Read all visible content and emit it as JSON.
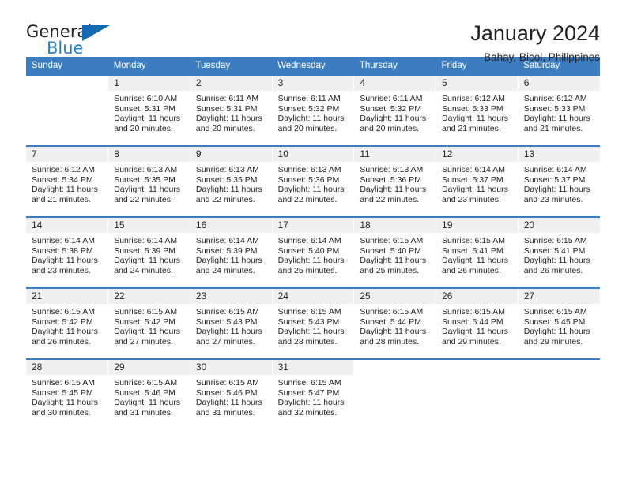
{
  "brand": {
    "name_part1": "General",
    "name_part2": "Blue",
    "triangle_color": "#1268b3",
    "blue_color": "#2a7fc4"
  },
  "header": {
    "title": "January 2024",
    "subtitle": "Bahay, Bicol, Philippines"
  },
  "theme": {
    "header_bg": "#3b7dc0",
    "daynum_bg": "#f0f0f0",
    "text_color": "#231f20"
  },
  "calendar": {
    "weekdays": [
      "Sunday",
      "Monday",
      "Tuesday",
      "Wednesday",
      "Thursday",
      "Friday",
      "Saturday"
    ],
    "weeks": [
      [
        {
          "day": ""
        },
        {
          "day": "1",
          "sunrise": "Sunrise: 6:10 AM",
          "sunset": "Sunset: 5:31 PM",
          "daylight1": "Daylight: 11 hours",
          "daylight2": "and 20 minutes."
        },
        {
          "day": "2",
          "sunrise": "Sunrise: 6:11 AM",
          "sunset": "Sunset: 5:31 PM",
          "daylight1": "Daylight: 11 hours",
          "daylight2": "and 20 minutes."
        },
        {
          "day": "3",
          "sunrise": "Sunrise: 6:11 AM",
          "sunset": "Sunset: 5:32 PM",
          "daylight1": "Daylight: 11 hours",
          "daylight2": "and 20 minutes."
        },
        {
          "day": "4",
          "sunrise": "Sunrise: 6:11 AM",
          "sunset": "Sunset: 5:32 PM",
          "daylight1": "Daylight: 11 hours",
          "daylight2": "and 20 minutes."
        },
        {
          "day": "5",
          "sunrise": "Sunrise: 6:12 AM",
          "sunset": "Sunset: 5:33 PM",
          "daylight1": "Daylight: 11 hours",
          "daylight2": "and 21 minutes."
        },
        {
          "day": "6",
          "sunrise": "Sunrise: 6:12 AM",
          "sunset": "Sunset: 5:33 PM",
          "daylight1": "Daylight: 11 hours",
          "daylight2": "and 21 minutes."
        }
      ],
      [
        {
          "day": "7",
          "sunrise": "Sunrise: 6:12 AM",
          "sunset": "Sunset: 5:34 PM",
          "daylight1": "Daylight: 11 hours",
          "daylight2": "and 21 minutes."
        },
        {
          "day": "8",
          "sunrise": "Sunrise: 6:13 AM",
          "sunset": "Sunset: 5:35 PM",
          "daylight1": "Daylight: 11 hours",
          "daylight2": "and 22 minutes."
        },
        {
          "day": "9",
          "sunrise": "Sunrise: 6:13 AM",
          "sunset": "Sunset: 5:35 PM",
          "daylight1": "Daylight: 11 hours",
          "daylight2": "and 22 minutes."
        },
        {
          "day": "10",
          "sunrise": "Sunrise: 6:13 AM",
          "sunset": "Sunset: 5:36 PM",
          "daylight1": "Daylight: 11 hours",
          "daylight2": "and 22 minutes."
        },
        {
          "day": "11",
          "sunrise": "Sunrise: 6:13 AM",
          "sunset": "Sunset: 5:36 PM",
          "daylight1": "Daylight: 11 hours",
          "daylight2": "and 22 minutes."
        },
        {
          "day": "12",
          "sunrise": "Sunrise: 6:14 AM",
          "sunset": "Sunset: 5:37 PM",
          "daylight1": "Daylight: 11 hours",
          "daylight2": "and 23 minutes."
        },
        {
          "day": "13",
          "sunrise": "Sunrise: 6:14 AM",
          "sunset": "Sunset: 5:37 PM",
          "daylight1": "Daylight: 11 hours",
          "daylight2": "and 23 minutes."
        }
      ],
      [
        {
          "day": "14",
          "sunrise": "Sunrise: 6:14 AM",
          "sunset": "Sunset: 5:38 PM",
          "daylight1": "Daylight: 11 hours",
          "daylight2": "and 23 minutes."
        },
        {
          "day": "15",
          "sunrise": "Sunrise: 6:14 AM",
          "sunset": "Sunset: 5:39 PM",
          "daylight1": "Daylight: 11 hours",
          "daylight2": "and 24 minutes."
        },
        {
          "day": "16",
          "sunrise": "Sunrise: 6:14 AM",
          "sunset": "Sunset: 5:39 PM",
          "daylight1": "Daylight: 11 hours",
          "daylight2": "and 24 minutes."
        },
        {
          "day": "17",
          "sunrise": "Sunrise: 6:14 AM",
          "sunset": "Sunset: 5:40 PM",
          "daylight1": "Daylight: 11 hours",
          "daylight2": "and 25 minutes."
        },
        {
          "day": "18",
          "sunrise": "Sunrise: 6:15 AM",
          "sunset": "Sunset: 5:40 PM",
          "daylight1": "Daylight: 11 hours",
          "daylight2": "and 25 minutes."
        },
        {
          "day": "19",
          "sunrise": "Sunrise: 6:15 AM",
          "sunset": "Sunset: 5:41 PM",
          "daylight1": "Daylight: 11 hours",
          "daylight2": "and 26 minutes."
        },
        {
          "day": "20",
          "sunrise": "Sunrise: 6:15 AM",
          "sunset": "Sunset: 5:41 PM",
          "daylight1": "Daylight: 11 hours",
          "daylight2": "and 26 minutes."
        }
      ],
      [
        {
          "day": "21",
          "sunrise": "Sunrise: 6:15 AM",
          "sunset": "Sunset: 5:42 PM",
          "daylight1": "Daylight: 11 hours",
          "daylight2": "and 26 minutes."
        },
        {
          "day": "22",
          "sunrise": "Sunrise: 6:15 AM",
          "sunset": "Sunset: 5:42 PM",
          "daylight1": "Daylight: 11 hours",
          "daylight2": "and 27 minutes."
        },
        {
          "day": "23",
          "sunrise": "Sunrise: 6:15 AM",
          "sunset": "Sunset: 5:43 PM",
          "daylight1": "Daylight: 11 hours",
          "daylight2": "and 27 minutes."
        },
        {
          "day": "24",
          "sunrise": "Sunrise: 6:15 AM",
          "sunset": "Sunset: 5:43 PM",
          "daylight1": "Daylight: 11 hours",
          "daylight2": "and 28 minutes."
        },
        {
          "day": "25",
          "sunrise": "Sunrise: 6:15 AM",
          "sunset": "Sunset: 5:44 PM",
          "daylight1": "Daylight: 11 hours",
          "daylight2": "and 28 minutes."
        },
        {
          "day": "26",
          "sunrise": "Sunrise: 6:15 AM",
          "sunset": "Sunset: 5:44 PM",
          "daylight1": "Daylight: 11 hours",
          "daylight2": "and 29 minutes."
        },
        {
          "day": "27",
          "sunrise": "Sunrise: 6:15 AM",
          "sunset": "Sunset: 5:45 PM",
          "daylight1": "Daylight: 11 hours",
          "daylight2": "and 29 minutes."
        }
      ],
      [
        {
          "day": "28",
          "sunrise": "Sunrise: 6:15 AM",
          "sunset": "Sunset: 5:45 PM",
          "daylight1": "Daylight: 11 hours",
          "daylight2": "and 30 minutes."
        },
        {
          "day": "29",
          "sunrise": "Sunrise: 6:15 AM",
          "sunset": "Sunset: 5:46 PM",
          "daylight1": "Daylight: 11 hours",
          "daylight2": "and 31 minutes."
        },
        {
          "day": "30",
          "sunrise": "Sunrise: 6:15 AM",
          "sunset": "Sunset: 5:46 PM",
          "daylight1": "Daylight: 11 hours",
          "daylight2": "and 31 minutes."
        },
        {
          "day": "31",
          "sunrise": "Sunrise: 6:15 AM",
          "sunset": "Sunset: 5:47 PM",
          "daylight1": "Daylight: 11 hours",
          "daylight2": "and 32 minutes."
        },
        {
          "day": ""
        },
        {
          "day": ""
        },
        {
          "day": ""
        }
      ]
    ]
  }
}
